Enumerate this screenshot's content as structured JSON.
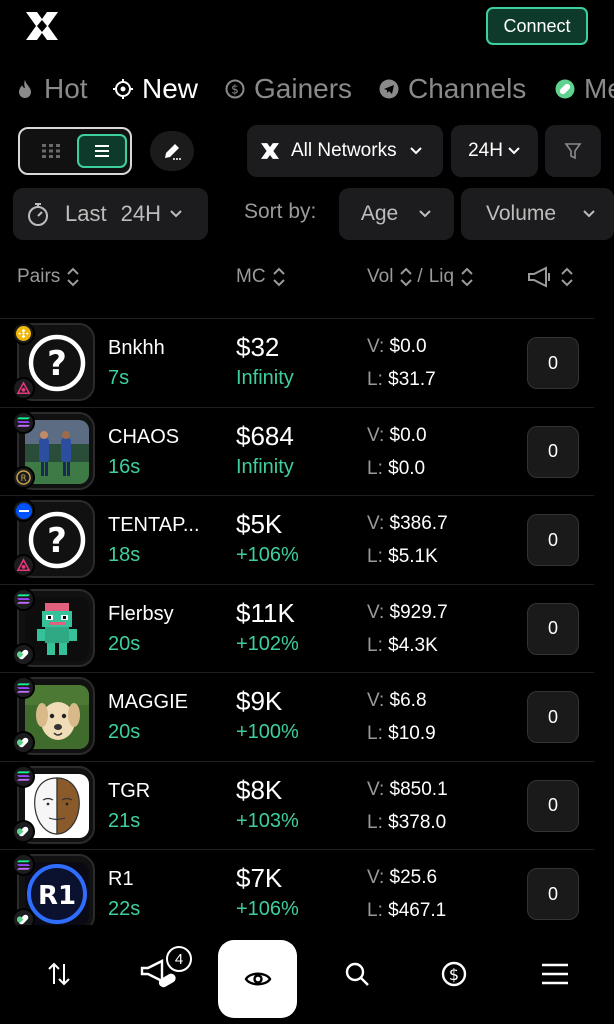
{
  "header": {
    "connect_label": "Connect"
  },
  "tabs": [
    {
      "label": "Hot",
      "icon": "flame-icon"
    },
    {
      "label": "New",
      "icon": "crosshair-icon",
      "active": true
    },
    {
      "label": "Gainers",
      "icon": "dollar-icon"
    },
    {
      "label": "Channels",
      "icon": "telegram-icon"
    },
    {
      "label": "Me",
      "icon": "pill-icon"
    }
  ],
  "controls": {
    "network_label": "All Networks",
    "range_label": "24H",
    "last_prefix": "Last",
    "last_value": "24H",
    "sort_label": "Sort by:",
    "sort_age": "Age",
    "sort_volume": "Volume"
  },
  "table_header": {
    "pairs": "Pairs",
    "mc": "MC",
    "vol": "Vol",
    "slash": "/",
    "liq": "Liq"
  },
  "rows": [
    {
      "name": "Bnkhh",
      "age": "7s",
      "mc": "$32",
      "change": "Infinity",
      "v": "$0.0",
      "l": "$31.7",
      "count": "0",
      "chain": "bnb",
      "dex": "pancake",
      "img": "question"
    },
    {
      "name": "CHAOS",
      "age": "16s",
      "mc": "$684",
      "change": "Infinity",
      "v": "$0.0",
      "l": "$0.0",
      "count": "0",
      "chain": "solana",
      "dex": "raydium",
      "img": "photo"
    },
    {
      "name": "TENTAP...",
      "age": "18s",
      "mc": "$5K",
      "change": "+106%",
      "v": "$386.7",
      "l": "$5.1K",
      "count": "0",
      "chain": "base",
      "dex": "pancake",
      "img": "question"
    },
    {
      "name": "Flerbsy",
      "age": "20s",
      "mc": "$11K",
      "change": "+102%",
      "v": "$929.7",
      "l": "$4.3K",
      "count": "0",
      "chain": "solana",
      "dex": "pump",
      "img": "frog"
    },
    {
      "name": "MAGGIE",
      "age": "20s",
      "mc": "$9K",
      "change": "+100%",
      "v": "$6.8",
      "l": "$10.9",
      "count": "0",
      "chain": "solana",
      "dex": "pump",
      "img": "dog"
    },
    {
      "name": "TGR",
      "age": "21s",
      "mc": "$8K",
      "change": "+103%",
      "v": "$850.1",
      "l": "$378.0",
      "count": "0",
      "chain": "solana",
      "dex": "pump",
      "img": "wojak"
    },
    {
      "name": "R1",
      "age": "22s",
      "mc": "$7K",
      "change": "+106%",
      "v": "$25.6",
      "l": "$467.1",
      "count": "0",
      "chain": "solana",
      "dex": "pump",
      "img": "r1"
    }
  ],
  "row_labels": {
    "v": "V:",
    "l": "L:"
  },
  "r1_text": "R1",
  "bottom_nav": {
    "megaphone_badge": "4"
  },
  "colors": {
    "accent": "#3ecf9e",
    "surface": "#1c1c1e",
    "muted": "#9a9a9a"
  }
}
